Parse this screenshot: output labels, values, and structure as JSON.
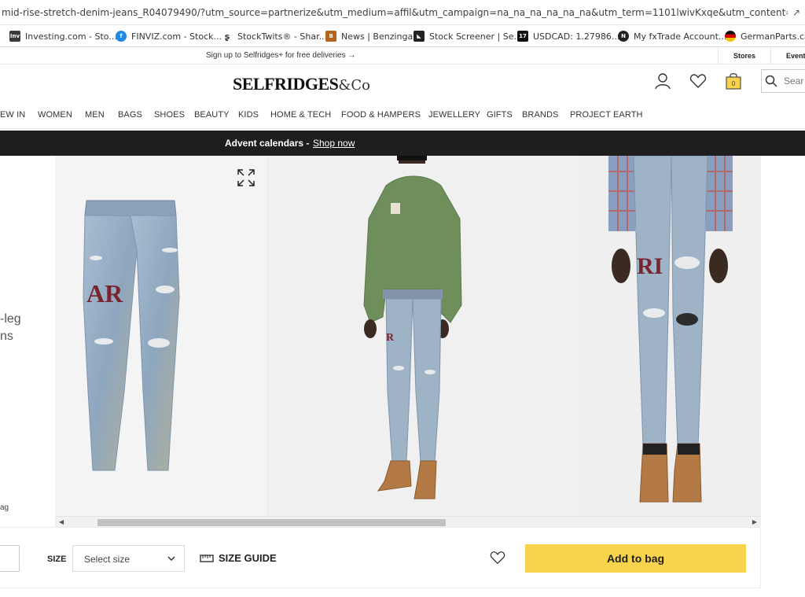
{
  "browser": {
    "url": "mid-rise-stretch-denim-jeans_R04079490/?utm_source=partnerize&utm_medium=affil&utm_campaign=na_na_na_na_na_na&utm_term=1101lwivKxqe&utm_content=laurenlyst&clic...",
    "bookmarks": [
      {
        "label": "Investing.com - Sto...",
        "icon": "investing-icon",
        "color": "#3a3a3a",
        "glyph": "Inv"
      },
      {
        "label": "FINVIZ.com - Stock...",
        "icon": "finviz-icon",
        "color": "#1e88e5",
        "glyph": "f"
      },
      {
        "label": "StockTwits® - Shar...",
        "icon": "stocktwits-icon",
        "color": "#333333",
        "glyph": "S"
      },
      {
        "label": "News | Benzinga",
        "icon": "benzinga-icon",
        "color": "#b5651d",
        "glyph": "B"
      },
      {
        "label": "Stock Screener | Se...",
        "icon": "screener-icon",
        "color": "#222222",
        "glyph": "◣"
      },
      {
        "label": "USDCAD: 1.27986...",
        "icon": "tradingview-icon",
        "color": "#111111",
        "glyph": "17"
      },
      {
        "label": "My fxTrade Account...",
        "icon": "oanda-icon",
        "color": "#222222",
        "glyph": "N"
      },
      {
        "label": "GermanParts.ca |",
        "icon": "germany-flag-icon",
        "color": "#d00000",
        "glyph": ""
      }
    ]
  },
  "topstrip": {
    "promo": "Sign up to Selfridges+ for free deliveries →",
    "stores": "Stores",
    "events": "Event"
  },
  "header": {
    "logo_main": "SELFRIDGES",
    "logo_amp": "&Co",
    "search_placeholder": "Sear"
  },
  "nav": [
    "EW IN",
    "WOMEN",
    "MEN",
    "BAGS",
    "SHOES",
    "BEAUTY",
    "KIDS",
    "HOME & TECH",
    "FOOD & HAMPERS",
    "JEWELLERY",
    "GIFTS",
    "BRANDS",
    "PROJECT EARTH"
  ],
  "banner": {
    "text": "Advent calendars -",
    "link": "Shop now"
  },
  "product": {
    "title_line1": "-leg",
    "title_line2": "ns",
    "small_text": "ag"
  },
  "actions": {
    "size_label": "SIZE",
    "size_select": "Select size",
    "size_guide": "SIZE GUIDE",
    "add_to_bag": "Add to bag"
  },
  "colors": {
    "accent_yellow": "#f7d44c",
    "banner_bg": "#1e1e1e",
    "denim": "#8fa8c2",
    "hoodie": "#6e8f5c"
  }
}
